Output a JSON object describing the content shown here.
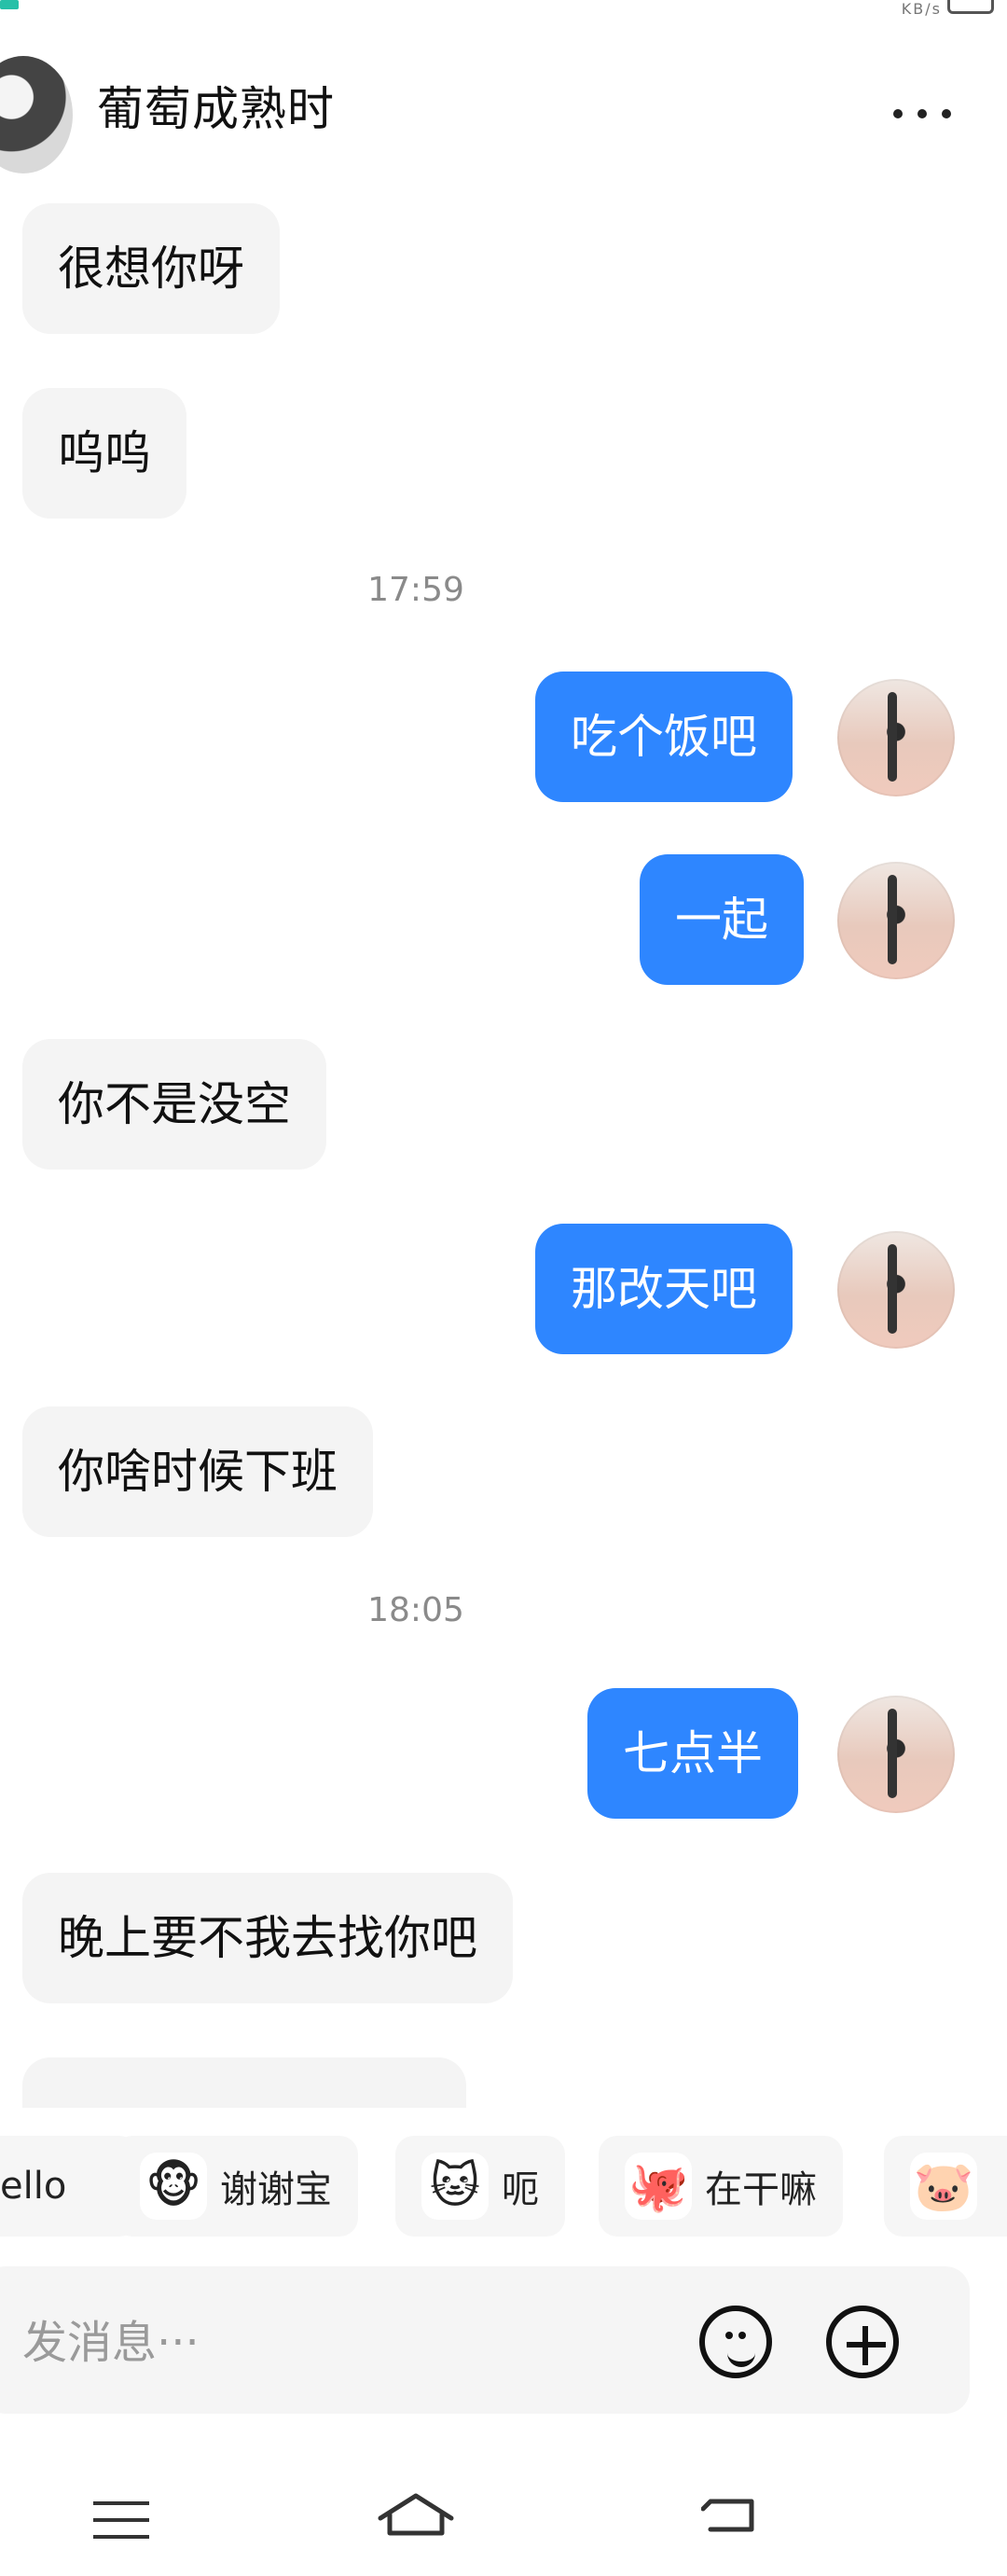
{
  "header": {
    "title": "葡萄成熟时",
    "more_label": "•••"
  },
  "messages": [
    {
      "side": "left",
      "text": "很想你呀"
    },
    {
      "side": "left",
      "text": "呜呜"
    },
    {
      "side": "time",
      "text": "17:59"
    },
    {
      "side": "right",
      "text": "吃个饭吧"
    },
    {
      "side": "right",
      "text": "一起"
    },
    {
      "side": "left",
      "text": "你不是没空"
    },
    {
      "side": "right",
      "text": "那改天吧"
    },
    {
      "side": "left",
      "text": "你啥时候下班"
    },
    {
      "side": "time",
      "text": "18:05"
    },
    {
      "side": "right",
      "text": "七点半"
    },
    {
      "side": "left",
      "text": "晚上要不我去找你吧"
    }
  ],
  "quick_replies": [
    {
      "label": "ello",
      "icon_name": "hello-sticker-icon"
    },
    {
      "label": "谢谢宝",
      "icon_name": "thanks-sticker-icon"
    },
    {
      "label": "呃",
      "icon_name": "cat-sticker-icon"
    },
    {
      "label": "在干嘛",
      "icon_name": "what-doing-sticker-icon"
    },
    {
      "label": "",
      "icon_name": "partial-sticker-icon"
    }
  ],
  "input": {
    "placeholder": "发消息···"
  }
}
